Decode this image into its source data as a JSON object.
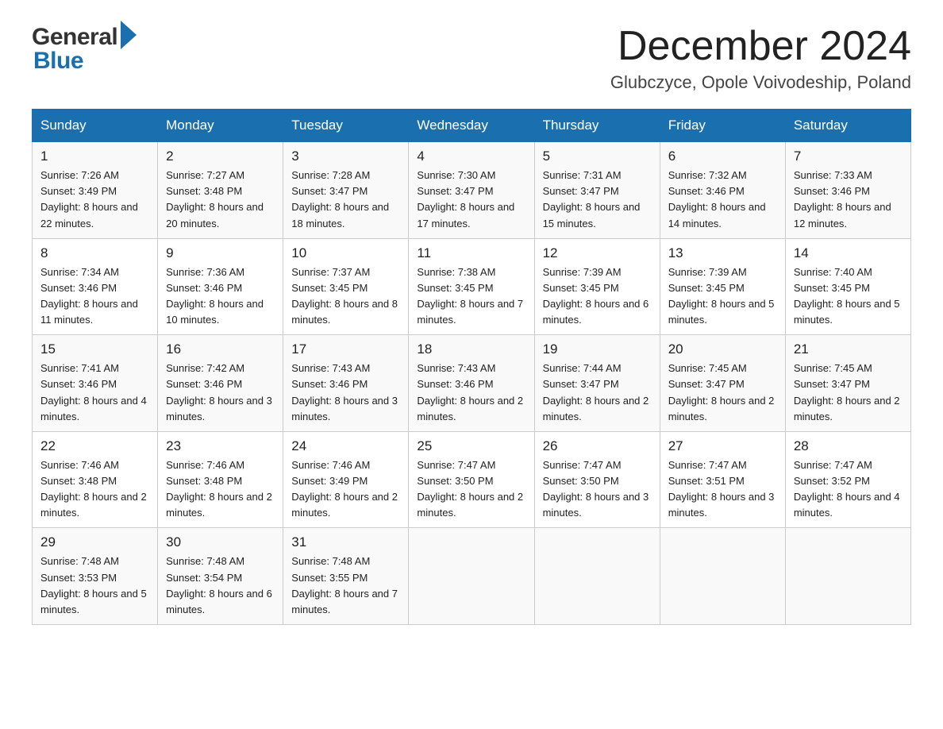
{
  "header": {
    "month_title": "December 2024",
    "location": "Glubczyce, Opole Voivodeship, Poland",
    "logo_general": "General",
    "logo_blue": "Blue"
  },
  "columns": [
    "Sunday",
    "Monday",
    "Tuesday",
    "Wednesday",
    "Thursday",
    "Friday",
    "Saturday"
  ],
  "weeks": [
    [
      {
        "day": "1",
        "sunrise": "7:26 AM",
        "sunset": "3:49 PM",
        "daylight": "8 hours and 22 minutes."
      },
      {
        "day": "2",
        "sunrise": "7:27 AM",
        "sunset": "3:48 PM",
        "daylight": "8 hours and 20 minutes."
      },
      {
        "day": "3",
        "sunrise": "7:28 AM",
        "sunset": "3:47 PM",
        "daylight": "8 hours and 18 minutes."
      },
      {
        "day": "4",
        "sunrise": "7:30 AM",
        "sunset": "3:47 PM",
        "daylight": "8 hours and 17 minutes."
      },
      {
        "day": "5",
        "sunrise": "7:31 AM",
        "sunset": "3:47 PM",
        "daylight": "8 hours and 15 minutes."
      },
      {
        "day": "6",
        "sunrise": "7:32 AM",
        "sunset": "3:46 PM",
        "daylight": "8 hours and 14 minutes."
      },
      {
        "day": "7",
        "sunrise": "7:33 AM",
        "sunset": "3:46 PM",
        "daylight": "8 hours and 12 minutes."
      }
    ],
    [
      {
        "day": "8",
        "sunrise": "7:34 AM",
        "sunset": "3:46 PM",
        "daylight": "8 hours and 11 minutes."
      },
      {
        "day": "9",
        "sunrise": "7:36 AM",
        "sunset": "3:46 PM",
        "daylight": "8 hours and 10 minutes."
      },
      {
        "day": "10",
        "sunrise": "7:37 AM",
        "sunset": "3:45 PM",
        "daylight": "8 hours and 8 minutes."
      },
      {
        "day": "11",
        "sunrise": "7:38 AM",
        "sunset": "3:45 PM",
        "daylight": "8 hours and 7 minutes."
      },
      {
        "day": "12",
        "sunrise": "7:39 AM",
        "sunset": "3:45 PM",
        "daylight": "8 hours and 6 minutes."
      },
      {
        "day": "13",
        "sunrise": "7:39 AM",
        "sunset": "3:45 PM",
        "daylight": "8 hours and 5 minutes."
      },
      {
        "day": "14",
        "sunrise": "7:40 AM",
        "sunset": "3:45 PM",
        "daylight": "8 hours and 5 minutes."
      }
    ],
    [
      {
        "day": "15",
        "sunrise": "7:41 AM",
        "sunset": "3:46 PM",
        "daylight": "8 hours and 4 minutes."
      },
      {
        "day": "16",
        "sunrise": "7:42 AM",
        "sunset": "3:46 PM",
        "daylight": "8 hours and 3 minutes."
      },
      {
        "day": "17",
        "sunrise": "7:43 AM",
        "sunset": "3:46 PM",
        "daylight": "8 hours and 3 minutes."
      },
      {
        "day": "18",
        "sunrise": "7:43 AM",
        "sunset": "3:46 PM",
        "daylight": "8 hours and 2 minutes."
      },
      {
        "day": "19",
        "sunrise": "7:44 AM",
        "sunset": "3:47 PM",
        "daylight": "8 hours and 2 minutes."
      },
      {
        "day": "20",
        "sunrise": "7:45 AM",
        "sunset": "3:47 PM",
        "daylight": "8 hours and 2 minutes."
      },
      {
        "day": "21",
        "sunrise": "7:45 AM",
        "sunset": "3:47 PM",
        "daylight": "8 hours and 2 minutes."
      }
    ],
    [
      {
        "day": "22",
        "sunrise": "7:46 AM",
        "sunset": "3:48 PM",
        "daylight": "8 hours and 2 minutes."
      },
      {
        "day": "23",
        "sunrise": "7:46 AM",
        "sunset": "3:48 PM",
        "daylight": "8 hours and 2 minutes."
      },
      {
        "day": "24",
        "sunrise": "7:46 AM",
        "sunset": "3:49 PM",
        "daylight": "8 hours and 2 minutes."
      },
      {
        "day": "25",
        "sunrise": "7:47 AM",
        "sunset": "3:50 PM",
        "daylight": "8 hours and 2 minutes."
      },
      {
        "day": "26",
        "sunrise": "7:47 AM",
        "sunset": "3:50 PM",
        "daylight": "8 hours and 3 minutes."
      },
      {
        "day": "27",
        "sunrise": "7:47 AM",
        "sunset": "3:51 PM",
        "daylight": "8 hours and 3 minutes."
      },
      {
        "day": "28",
        "sunrise": "7:47 AM",
        "sunset": "3:52 PM",
        "daylight": "8 hours and 4 minutes."
      }
    ],
    [
      {
        "day": "29",
        "sunrise": "7:48 AM",
        "sunset": "3:53 PM",
        "daylight": "8 hours and 5 minutes."
      },
      {
        "day": "30",
        "sunrise": "7:48 AM",
        "sunset": "3:54 PM",
        "daylight": "8 hours and 6 minutes."
      },
      {
        "day": "31",
        "sunrise": "7:48 AM",
        "sunset": "3:55 PM",
        "daylight": "8 hours and 7 minutes."
      },
      null,
      null,
      null,
      null
    ]
  ]
}
